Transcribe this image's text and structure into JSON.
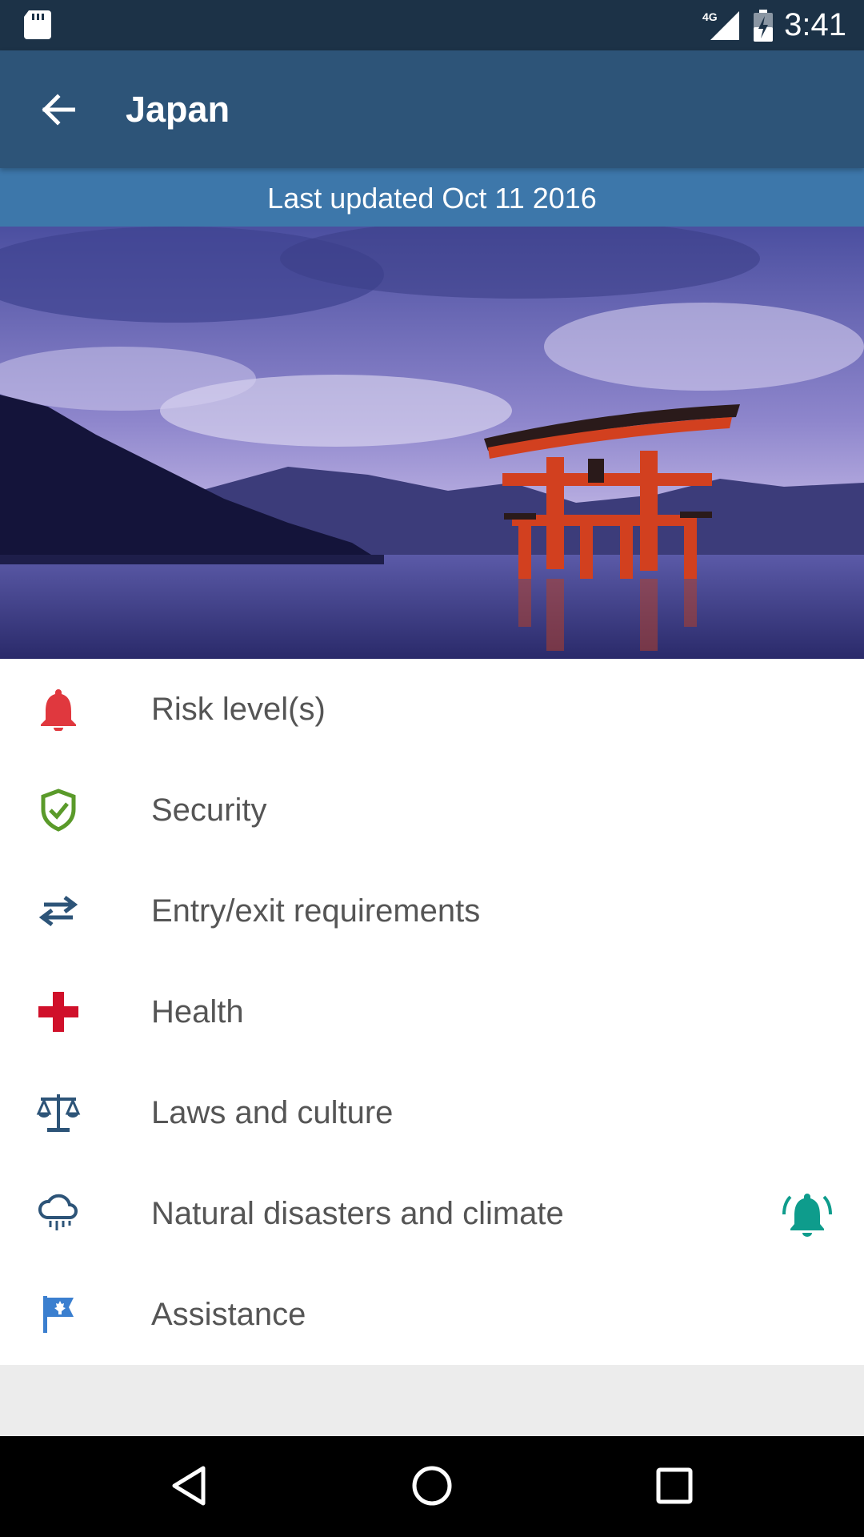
{
  "status_bar": {
    "time": "3:41",
    "network": "4G",
    "icons": [
      "sd-card-icon",
      "signal-icon",
      "battery-charging-icon"
    ]
  },
  "app_bar": {
    "title": "Japan",
    "back_icon": "arrow-left-icon"
  },
  "banner": {
    "text": "Last updated Oct 11 2016"
  },
  "hero_image": {
    "subject": "torii-gate-photo"
  },
  "menu": {
    "items": [
      {
        "label": "Risk level(s)",
        "icon": "bell-icon",
        "icon_color": "#e0383e"
      },
      {
        "label": "Security",
        "icon": "shield-check-icon",
        "icon_color": "#5a9a2a"
      },
      {
        "label": "Entry/exit requirements",
        "icon": "swap-arrows-icon",
        "icon_color": "#2d5478"
      },
      {
        "label": "Health",
        "icon": "medical-cross-icon",
        "icon_color": "#d0102a"
      },
      {
        "label": "Laws and culture",
        "icon": "scales-icon",
        "icon_color": "#2d5478"
      },
      {
        "label": "Natural disasters and climate",
        "icon": "storm-cloud-icon",
        "icon_color": "#2d5478",
        "alert_icon": "ringing-bell-icon",
        "alert_color": "#0e9c8c"
      },
      {
        "label": "Assistance",
        "icon": "canada-flag-icon",
        "icon_color": "#3b7fcf"
      }
    ]
  },
  "nav_bar": {
    "back": "triangle-back-icon",
    "home": "circle-home-icon",
    "recents": "square-recents-icon"
  },
  "colors": {
    "status_bar": "#1c3247",
    "app_bar": "#2d5478",
    "banner": "#3d77aa",
    "footer_gray": "#ececec"
  }
}
